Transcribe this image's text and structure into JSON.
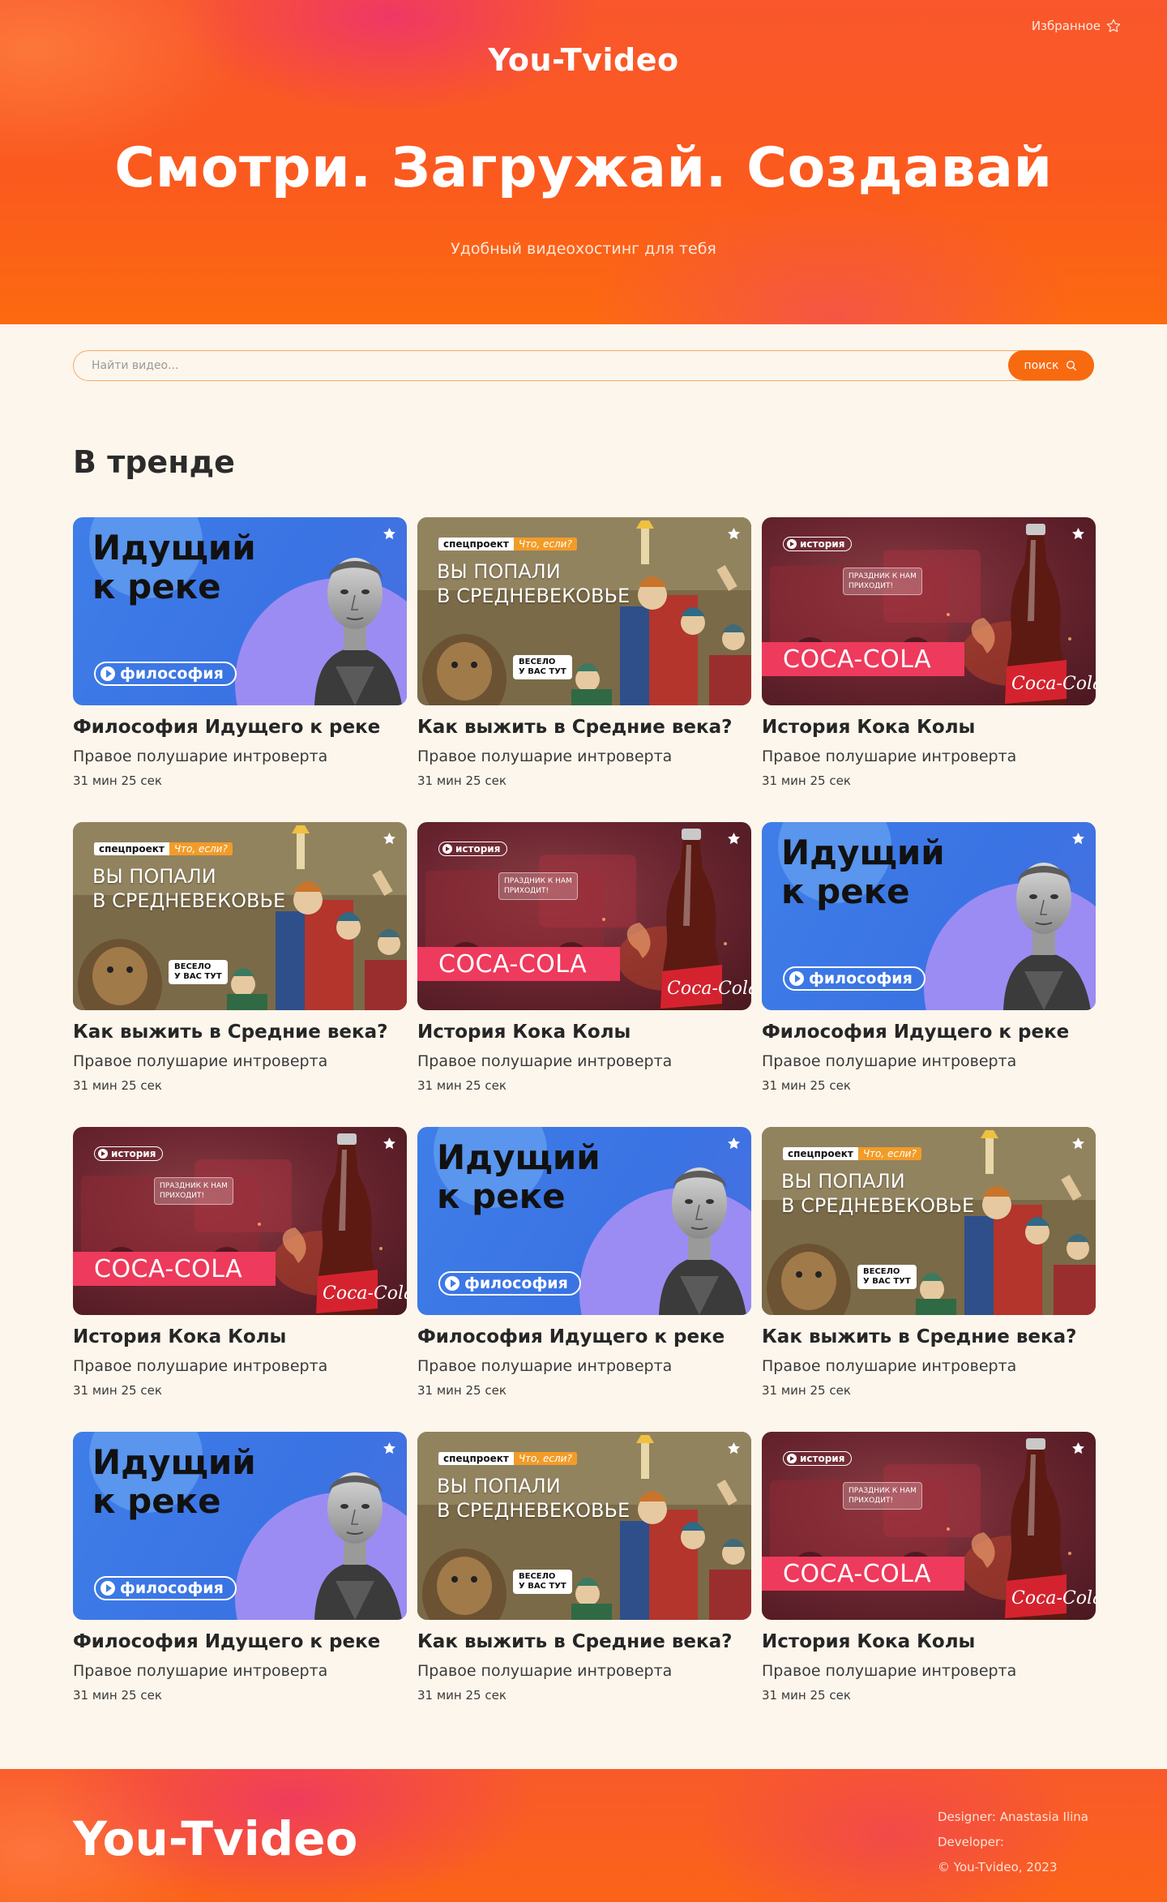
{
  "header": {
    "logo": "You-Tvideo",
    "favorites_label": "Избранное",
    "headline": "Смотри. Загружай. Создавай",
    "subtitle": "Удобный видеохостинг для тебя"
  },
  "search": {
    "placeholder": "Найти видео...",
    "button_label": "поиск"
  },
  "section": {
    "title": "В тренде"
  },
  "thumbs": {
    "philosophy": {
      "headline_line1": "Идущий",
      "headline_line2": "к реке",
      "tag": "философия"
    },
    "medieval": {
      "tag1": "спецпроект",
      "tag2": "Что, если?",
      "headline_line1": "ВЫ ПОПАЛИ",
      "headline_line2": "В СРЕДНЕВЕКОВЬЕ",
      "bubble_line1": "ВЕСЕЛО",
      "bubble_line2": "У ВАС ТУТ"
    },
    "coke": {
      "tag": "история",
      "note": "ПРАЗДНИК К НАМ ПРИХОДИТ!",
      "band": "COCA-COLA"
    }
  },
  "videos": [
    {
      "type": "philosophy",
      "title": "Философия Идущего к реке",
      "author": "Правое полушарие интроверта",
      "duration": "31 мин 25 сек"
    },
    {
      "type": "medieval",
      "title": "Как выжить в Средние века?",
      "author": "Правое полушарие интроверта",
      "duration": "31 мин 25 сек"
    },
    {
      "type": "coke",
      "title": "История Кока Колы",
      "author": "Правое полушарие интроверта",
      "duration": "31 мин 25 сек"
    },
    {
      "type": "medieval",
      "title": "Как выжить в Средние века?",
      "author": "Правое полушарие интроверта",
      "duration": "31 мин 25 сек"
    },
    {
      "type": "coke",
      "title": "История Кока Колы",
      "author": "Правое полушарие интроверта",
      "duration": "31 мин 25 сек"
    },
    {
      "type": "philosophy",
      "title": "Философия Идущего к реке",
      "author": "Правое полушарие интроверта",
      "duration": "31 мин 25 сек"
    },
    {
      "type": "coke",
      "title": "История Кока Колы",
      "author": "Правое полушарие интроверта",
      "duration": "31 мин 25 сек"
    },
    {
      "type": "philosophy",
      "title": "Философия Идущего к реке",
      "author": "Правое полушарие интроверта",
      "duration": "31 мин 25 сек"
    },
    {
      "type": "medieval",
      "title": "Как выжить в Средние века?",
      "author": "Правое полушарие интроверта",
      "duration": "31 мин 25 сек"
    },
    {
      "type": "philosophy",
      "title": "Философия Идущего к реке",
      "author": "Правое полушарие интроверта",
      "duration": "31 мин 25 сек"
    },
    {
      "type": "medieval",
      "title": "Как выжить в Средние века?",
      "author": "Правое полушарие интроверта",
      "duration": "31 мин 25 сек"
    },
    {
      "type": "coke",
      "title": "История Кока Колы",
      "author": "Правое полушарие интроверта",
      "duration": "31 мин 25 сек"
    }
  ],
  "footer": {
    "logo": "You-Tvideo",
    "designer": "Designer: Anastasia Ilina",
    "developer": "Developer:",
    "copyright": "© You-Tvideo, 2023"
  },
  "colors": {
    "accent": "#f76a10",
    "background": "#fdf6ec",
    "hero_pink": "#ec2d78",
    "philosophy_blue": "#3f7ee8",
    "coke_red": "#ee3a5c"
  },
  "icons": {
    "favorites": "star-outline-icon",
    "search": "search-icon",
    "card_favorite": "star-icon",
    "play": "play-icon"
  }
}
